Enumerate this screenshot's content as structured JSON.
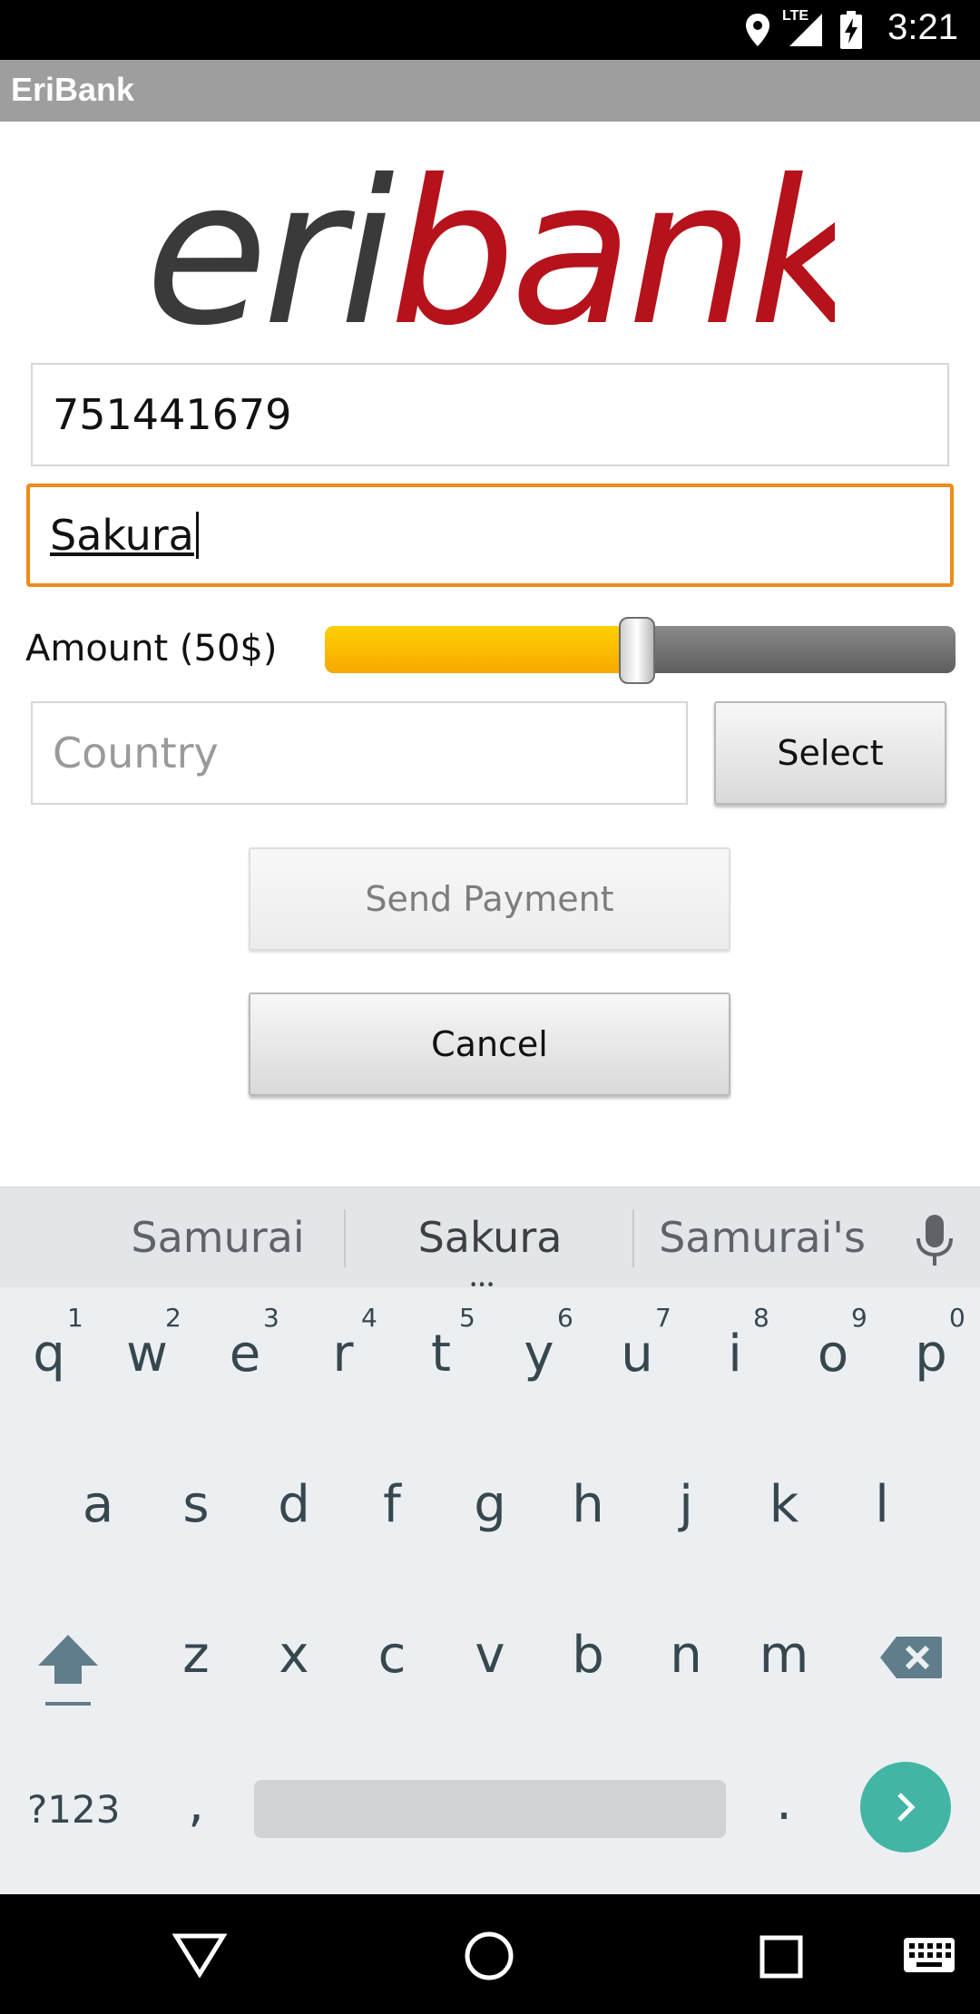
{
  "status_bar": {
    "time": "3:21",
    "network": "LTE",
    "icons": [
      "location-icon",
      "signal-icon",
      "battery-charging-icon"
    ]
  },
  "app_bar": {
    "title": "EriBank"
  },
  "logo": {
    "part1": "eri",
    "part2": "bank",
    "color1": "#3a3a3a",
    "color2": "#b5121b"
  },
  "form": {
    "phone_value": "751441679",
    "name_value": "Sakura",
    "amount_label": "Amount (50$)",
    "amount_slider": {
      "value": 50,
      "max": 100
    },
    "country_placeholder": "Country",
    "select_label": "Select",
    "send_label": "Send Payment",
    "cancel_label": "Cancel"
  },
  "keyboard": {
    "suggestions": [
      "Samurai",
      "Sakura",
      "Samurai's"
    ],
    "row1": [
      "q",
      "w",
      "e",
      "r",
      "t",
      "y",
      "u",
      "i",
      "o",
      "p"
    ],
    "row1_hints": [
      "1",
      "2",
      "3",
      "4",
      "5",
      "6",
      "7",
      "8",
      "9",
      "0"
    ],
    "row2": [
      "a",
      "s",
      "d",
      "f",
      "g",
      "h",
      "j",
      "k",
      "l"
    ],
    "row3": [
      "z",
      "x",
      "c",
      "v",
      "b",
      "n",
      "m"
    ],
    "symbols_label": "?123",
    "comma": ",",
    "period": ".",
    "accent_color": "#42b5a4"
  },
  "navigation": {
    "icons": [
      "back-icon",
      "home-icon",
      "recents-icon",
      "keyboard-icon"
    ]
  }
}
